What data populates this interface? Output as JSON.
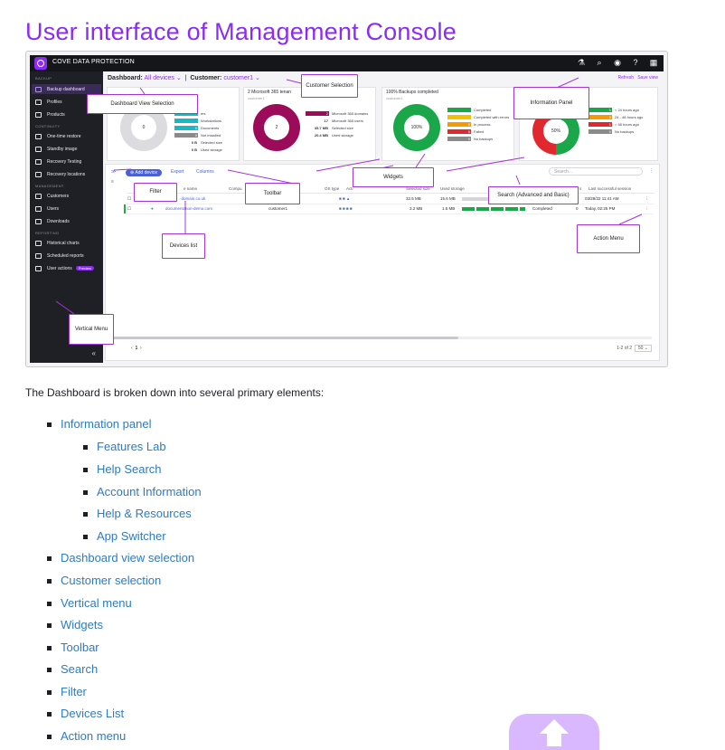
{
  "page": {
    "title": "User interface of Management Console"
  },
  "screenshot": {
    "brand": "COVE DATA PROTECTION",
    "top_icons": [
      "flask-icon",
      "search-icon",
      "account-icon",
      "help-icon",
      "app-grid-icon"
    ],
    "sidebar": {
      "sections": [
        "BACKUP",
        "CONTINUITY",
        "MANAGEMENT",
        "REPORTING"
      ],
      "items": [
        {
          "label": "Backup dashboard"
        },
        {
          "label": "Profiles"
        },
        {
          "label": "Products"
        },
        {
          "label": "One-time restore"
        },
        {
          "label": "Standby image"
        },
        {
          "label": "Recovery Testing"
        },
        {
          "label": "Recovery locations"
        },
        {
          "label": "Customers"
        },
        {
          "label": "Users"
        },
        {
          "label": "Downloads"
        },
        {
          "label": "Historical charts"
        },
        {
          "label": "Scheduled reports"
        },
        {
          "label": "User actions"
        }
      ],
      "preview_badge": "Preview",
      "collapse": "«"
    },
    "header": {
      "dashboard_label": "Dashboard:",
      "dashboard_value": "All devices",
      "customer_label": "Customer:",
      "customer_value": "customer1",
      "refresh": "Refresh",
      "save_view": "Save view"
    },
    "widgets": [
      {
        "title": "",
        "sub": "",
        "center": "0",
        "legend": [
          {
            "value": "",
            "text": "ers",
            "color": "#18b8c4"
          },
          {
            "value": "",
            "text": "Workstations",
            "color": "#18b8c4"
          },
          {
            "value": "0",
            "text": "Documents",
            "color": "#18b8c4"
          },
          {
            "value": "0",
            "text": "Not installed",
            "color": "#8a8a8a"
          },
          {
            "value": "0 B",
            "text": "Selected size",
            "color": ""
          },
          {
            "value": "0 B",
            "text": "Used storage",
            "color": ""
          }
        ]
      },
      {
        "title": "2 Microsoft 365 tenan",
        "sub": "customer1",
        "center": "2",
        "legend": [
          {
            "value": "2",
            "text": "Microsoft 365 domains",
            "color": "#9c0b5a"
          },
          {
            "value": "17",
            "text": "Microsoft 365 users",
            "color": ""
          },
          {
            "value": "35.7 MB",
            "text": "Selected size",
            "color": ""
          },
          {
            "value": "20.4 MB",
            "text": "Used storage",
            "color": ""
          }
        ]
      },
      {
        "title": "100% Backups completed",
        "sub": "customer1",
        "center": "100%",
        "legend": [
          {
            "value": "",
            "text": "Completed",
            "color": "#1aa74a"
          },
          {
            "value": "",
            "text": "Completed with errors",
            "color": "#f2c200"
          },
          {
            "value": "0",
            "text": "In process",
            "color": "#f59a00"
          },
          {
            "value": "0",
            "text": "Failed",
            "color": "#e0282e"
          },
          {
            "value": "0",
            "text": "No backups",
            "color": "#8a8a8a"
          }
        ]
      },
      {
        "title": "",
        "sub": "",
        "center": "50%",
        "legend": [
          {
            "value": "1",
            "text": "< 24 hours ago",
            "color": "#1aa74a"
          },
          {
            "value": "0",
            "text": "24 - 48 hours ago",
            "color": "#f59a00"
          },
          {
            "value": "1",
            "text": "> 48 hours ago",
            "color": "#e0282e"
          },
          {
            "value": "0",
            "text": "No backups",
            "color": "#8a8a8a"
          }
        ]
      }
    ],
    "toolbar": {
      "add_device": "Add device",
      "export": "Export",
      "columns": "Columns",
      "search_placeholder": "Search..."
    },
    "columns": [
      "e name",
      "Compu",
      "OS type",
      "Acti",
      "Selected size",
      "Used storage",
      "s",
      "Last successful session"
    ],
    "rows": [
      {
        "name": "-domain.co.uk",
        "customer": "",
        "selected": "32.5 MB",
        "used": "15.6 MB",
        "status": "",
        "errors": "0",
        "last": "03/28/22 11:41 AM"
      },
      {
        "name": "documentation-demo.com",
        "customer": "customer1",
        "selected": "3.2 MB",
        "used": "1.5 MB",
        "status": "Completed",
        "errors": "0",
        "last": "Today, 02:25 PM"
      }
    ],
    "pager": {
      "page": "1",
      "range": "1-2 of 2",
      "per_page": "50"
    }
  },
  "callouts": {
    "customer_selection": "Customer Selection",
    "dashboard_view": "Dashboard View Selection",
    "information_panel": "Information Panel",
    "widgets": "Widgets",
    "filter": "Filter",
    "toolbar": "Toolbar",
    "search": "Search (Advanced and Basic)",
    "devices_list": "Devices list",
    "action_menu": "Action Menu",
    "vertical_menu": "Vertical Menu"
  },
  "intro": "The Dashboard is broken down into several primary elements:",
  "list": [
    {
      "label": "Information panel",
      "level": 1
    },
    {
      "label": "Features Lab",
      "level": 2
    },
    {
      "label": "Help Search",
      "level": 2
    },
    {
      "label": "Account Information",
      "level": 2
    },
    {
      "label": "Help & Resources",
      "level": 2
    },
    {
      "label": "App Switcher",
      "level": 2
    },
    {
      "label": "Dashboard view selection",
      "level": 1
    },
    {
      "label": "Customer selection",
      "level": 1
    },
    {
      "label": "Vertical menu",
      "level": 1
    },
    {
      "label": "Widgets",
      "level": 1
    },
    {
      "label": "Toolbar",
      "level": 1
    },
    {
      "label": "Search",
      "level": 1
    },
    {
      "label": "Filter",
      "level": 1
    },
    {
      "label": "Devices List",
      "level": 1
    },
    {
      "label": "Action menu",
      "level": 1
    }
  ],
  "back_to_top_icon": "arrow-up-icon"
}
